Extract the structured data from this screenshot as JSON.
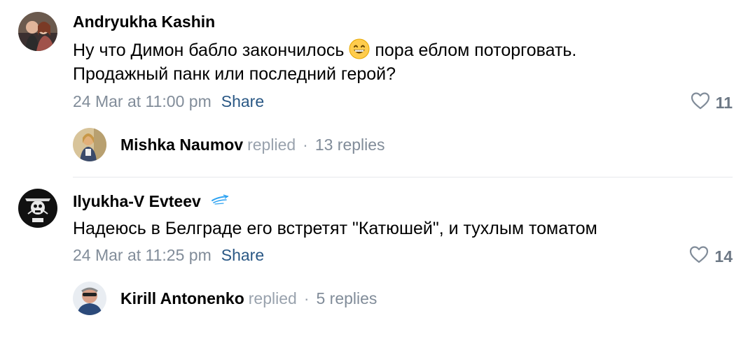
{
  "comments": [
    {
      "author": "Andryukha Kashin",
      "text_line1_a": "Ну что Димон бабло закончилось",
      "text_line1_b": "пора еблом поторговать.",
      "text_line2": "Продажный панк или последний герой?",
      "emoji": "grinning-face-with-smiling-eyes",
      "date": "24 Mar at 11:00 pm",
      "share_label": "Share",
      "likes": "11",
      "reply": {
        "name": "Mishka Naumov",
        "verb": "replied",
        "dot": "·",
        "count": "13 replies"
      }
    },
    {
      "author": "Ilyukha-V Evteev",
      "text_line1": "Надеюсь в Белграде его встретят \"Катюшей\", и тухлым томатом",
      "date": "24 Mar at 11:25 pm",
      "share_label": "Share",
      "likes": "14",
      "reply": {
        "name": "Kirill Antonenko",
        "verb": "replied",
        "dot": "·",
        "count": "5 replies"
      }
    }
  ],
  "colors": {
    "link": "#2a5885",
    "meta": "#818c99",
    "divider": "#e7e8ec"
  }
}
